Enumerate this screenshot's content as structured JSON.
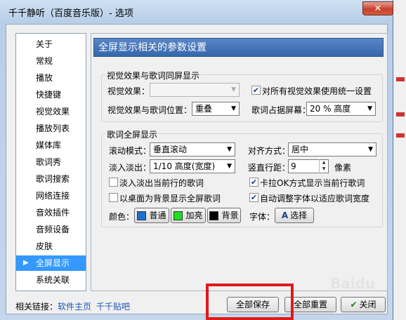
{
  "window": {
    "title": "千千静听（百度音乐版）- 选项",
    "close_glyph": "✕"
  },
  "nav": {
    "items": [
      "关于",
      "常规",
      "播放",
      "快捷键",
      "视觉效果",
      "播放列表",
      "媒体库",
      "歌词秀",
      "歌词搜索",
      "网络连接",
      "音效插件",
      "音频设备",
      "皮肤",
      "全屏显示",
      "系统关联"
    ],
    "selected": "全屏显示",
    "selected_arrow": "▶"
  },
  "banner": {
    "title": "全屏显示相关的参数设置"
  },
  "visual_group": {
    "title": "视觉效果与歌词同屏显示",
    "effect_label": "视觉效果：",
    "effect_value": "",
    "unify_label": "对所有视觉效果使用统一设置",
    "unify_checked": true,
    "position_label": "视觉效果与歌词位置：",
    "position_value": "重叠",
    "ratio_label": "歌词占据屏幕：",
    "ratio_value": "20 % 高度"
  },
  "lyrics_group": {
    "title": "歌词全屏显示",
    "scroll_label": "滚动模式：",
    "scroll_value": "垂直滚动",
    "align_label": "对齐方式：",
    "align_value": "居中",
    "fade_label": "淡入淡出：",
    "fade_value": "1/10 高度(宽度)",
    "spacing_label": "竖直行距：",
    "spacing_value": "9",
    "spacing_unit": "像素",
    "fade_current_label": "淡入淡出当前行的歌词",
    "fade_current_checked": false,
    "karaoke_label": "卡拉OK方式显示当前行歌词",
    "karaoke_checked": true,
    "desktop_bg_label": "以桌面为背景显示全屏歌词",
    "desktop_bg_checked": false,
    "autofit_label": "自动调整字体以适应歌词宽度",
    "autofit_checked": true,
    "color_label": "颜色：",
    "normal_label": "普通",
    "highlight_label": "加亮",
    "background_label": "背景",
    "normal_color": "#1e6fd0",
    "highlight_color": "#1ee01e",
    "background_color": "#000000",
    "font_label": "字体：",
    "font_button": "选择"
  },
  "footer": {
    "related_label": "相关链接：",
    "link1": "软件主页",
    "link2": "千千贴吧",
    "save_all": "全部保存",
    "reset_all": "全部重置",
    "close": "关闭"
  },
  "watermark": "Baidu"
}
